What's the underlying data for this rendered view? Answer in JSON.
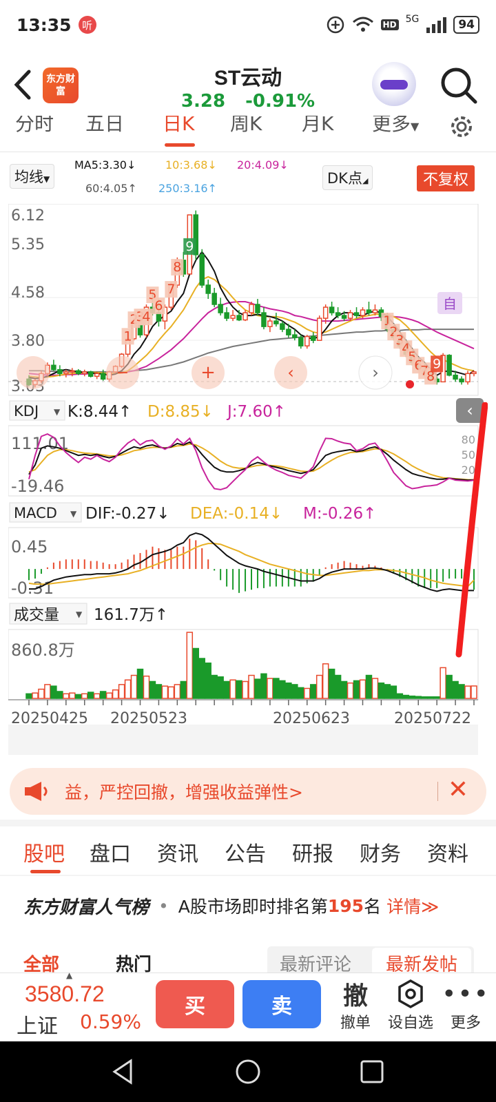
{
  "status_bar": {
    "time": "13:35",
    "app_badge": "听",
    "network": "5G",
    "hd": "HD",
    "battery": "94"
  },
  "header": {
    "logo_text": "东方财富",
    "stock_name": "ST云动",
    "price": "3.28",
    "change_pct": "-0.91%"
  },
  "period_tabs": [
    "分时",
    "五日",
    "日K",
    "周K",
    "月K",
    "更多"
  ],
  "ma_bar": {
    "selector": "均线",
    "ma5": "MA5:3.30↓",
    "ma10": "10:3.68↓",
    "ma20": "20:4.09↓",
    "ma60": "60:4.05↑",
    "ma250": "250:3.16↑",
    "dk_selector": "DK点",
    "fq_button": "不复权"
  },
  "indicators": {
    "kdj": {
      "selector": "KDJ",
      "k": "K:8.44↑",
      "d": "D:8.85↓",
      "j": "J:7.60↑"
    },
    "macd": {
      "selector": "MACD",
      "dif": "DIF:-0.27↓",
      "dea": "DEA:-0.14↓",
      "m": "M:-0.26↑"
    },
    "volume": {
      "selector": "成交量",
      "value": "161.7万↑"
    }
  },
  "colors": {
    "up": "#e8492c",
    "down": "#1a9a2a",
    "ma5": "#111111",
    "ma10": "#e8b024",
    "ma20": "#c8239c",
    "ma60": "#777777",
    "ma250": "#4aa3e0"
  },
  "chart_data": {
    "type": "candlestick",
    "price_axis_labels": [
      "6.12",
      "5.35",
      "4.58",
      "3.80",
      "3.03"
    ],
    "kdj_axis_labels": [
      "111.01",
      "-19.46"
    ],
    "kdj_ref_labels": [
      "80",
      "50",
      "20"
    ],
    "macd_axis_labels": [
      "0.45",
      "-0.31"
    ],
    "volume_axis_label": "860.8万",
    "date_labels": [
      "20250425",
      "20250523",
      "20250623",
      "20250722"
    ],
    "nine_turn_marks_up": [
      "1",
      "2",
      "3",
      "4",
      "5",
      "6",
      "7",
      "8",
      "9"
    ],
    "nine_turn_marks_down": [
      "1",
      "2",
      "3",
      "4",
      "5",
      "6",
      "7",
      "8",
      "9"
    ],
    "overlay_mark": "自",
    "candles": [
      [
        3.15,
        3.22,
        3.02,
        3.05
      ],
      [
        3.05,
        3.15,
        3.0,
        3.12
      ],
      [
        3.12,
        3.3,
        3.08,
        3.25
      ],
      [
        3.25,
        3.45,
        3.2,
        3.4
      ],
      [
        3.4,
        3.5,
        3.3,
        3.32
      ],
      [
        3.32,
        3.4,
        3.2,
        3.25
      ],
      [
        3.25,
        3.32,
        3.18,
        3.28
      ],
      [
        3.28,
        3.35,
        3.2,
        3.3
      ],
      [
        3.3,
        3.33,
        3.22,
        3.25
      ],
      [
        3.25,
        3.32,
        3.2,
        3.28
      ],
      [
        3.28,
        3.3,
        3.18,
        3.2
      ],
      [
        3.2,
        3.28,
        3.15,
        3.25
      ],
      [
        3.25,
        3.32,
        3.12,
        3.15
      ],
      [
        3.15,
        3.3,
        3.1,
        3.28
      ],
      [
        3.28,
        3.4,
        3.25,
        3.38
      ],
      [
        3.38,
        3.62,
        3.35,
        3.6
      ],
      [
        3.6,
        3.9,
        3.55,
        3.88
      ],
      [
        3.88,
        4.25,
        3.85,
        4.2
      ],
      [
        4.2,
        4.3,
        3.9,
        3.95
      ],
      [
        3.95,
        4.5,
        3.9,
        4.45
      ],
      [
        4.45,
        4.75,
        4.3,
        4.35
      ],
      [
        4.35,
        4.6,
        4.1,
        4.2
      ],
      [
        4.2,
        4.5,
        4.05,
        4.45
      ],
      [
        4.45,
        4.9,
        4.4,
        4.85
      ],
      [
        4.85,
        5.35,
        4.8,
        5.3
      ],
      [
        5.3,
        5.45,
        5.0,
        5.05
      ],
      [
        5.05,
        6.12,
        5.05,
        6.12
      ],
      [
        6.12,
        6.2,
        5.3,
        5.4
      ],
      [
        5.4,
        5.5,
        4.8,
        4.85
      ],
      [
        4.85,
        4.95,
        4.6,
        4.7
      ],
      [
        4.7,
        4.8,
        4.45,
        4.5
      ],
      [
        4.5,
        4.62,
        4.3,
        4.35
      ],
      [
        4.35,
        4.45,
        4.2,
        4.25
      ],
      [
        4.25,
        4.4,
        4.2,
        4.3
      ],
      [
        4.3,
        4.4,
        4.2,
        4.22
      ],
      [
        4.22,
        4.4,
        4.2,
        4.35
      ],
      [
        4.35,
        4.55,
        4.3,
        4.5
      ],
      [
        4.5,
        4.6,
        4.3,
        4.35
      ],
      [
        4.35,
        4.45,
        4.05,
        4.1
      ],
      [
        4.1,
        4.25,
        4.0,
        4.2
      ],
      [
        4.2,
        4.35,
        4.1,
        4.15
      ],
      [
        4.15,
        4.2,
        4.0,
        4.05
      ],
      [
        4.05,
        4.15,
        3.9,
        3.95
      ],
      [
        3.95,
        4.05,
        3.85,
        3.9
      ],
      [
        3.9,
        3.95,
        3.7,
        3.75
      ],
      [
        3.75,
        3.95,
        3.7,
        3.92
      ],
      [
        3.92,
        4.0,
        3.8,
        3.85
      ],
      [
        3.85,
        4.3,
        3.85,
        4.25
      ],
      [
        4.25,
        4.5,
        4.15,
        4.45
      ],
      [
        4.45,
        4.55,
        4.3,
        4.35
      ],
      [
        4.35,
        4.45,
        4.25,
        4.3
      ],
      [
        4.3,
        4.38,
        4.2,
        4.25
      ],
      [
        4.25,
        4.4,
        4.2,
        4.35
      ],
      [
        4.35,
        4.45,
        4.25,
        4.3
      ],
      [
        4.3,
        4.45,
        4.25,
        4.4
      ],
      [
        4.4,
        4.55,
        4.3,
        4.35
      ],
      [
        4.35,
        4.5,
        4.3,
        4.4
      ],
      [
        4.4,
        4.45,
        4.2,
        4.28
      ],
      [
        4.28,
        4.35,
        4.0,
        4.05
      ],
      [
        4.05,
        4.15,
        3.85,
        3.9
      ],
      [
        3.9,
        4.0,
        3.7,
        3.75
      ],
      [
        3.75,
        3.85,
        3.55,
        3.6
      ],
      [
        3.6,
        3.7,
        3.4,
        3.45
      ],
      [
        3.45,
        3.55,
        3.3,
        3.35
      ],
      [
        3.35,
        3.45,
        3.2,
        3.25
      ],
      [
        3.25,
        3.35,
        3.1,
        3.15
      ],
      [
        3.15,
        3.2,
        3.05,
        3.1
      ],
      [
        3.1,
        3.62,
        3.1,
        3.58
      ],
      [
        3.58,
        3.6,
        3.2,
        3.22
      ],
      [
        3.22,
        3.3,
        3.1,
        3.15
      ],
      [
        3.15,
        3.2,
        3.05,
        3.1
      ],
      [
        3.1,
        3.3,
        3.05,
        3.25
      ],
      [
        3.25,
        3.3,
        3.2,
        3.28
      ]
    ],
    "volumes": [
      60,
      70,
      120,
      180,
      160,
      90,
      60,
      70,
      50,
      60,
      80,
      60,
      90,
      70,
      110,
      180,
      240,
      300,
      380,
      290,
      220,
      180,
      160,
      150,
      180,
      220,
      860,
      650,
      520,
      460,
      300,
      280,
      220,
      240,
      230,
      220,
      300,
      250,
      320,
      260,
      260,
      230,
      200,
      180,
      140,
      130,
      180,
      300,
      450,
      380,
      300,
      220,
      200,
      230,
      240,
      300,
      260,
      200,
      180,
      160,
      60,
      40,
      30,
      25,
      20,
      20,
      20,
      400,
      300,
      220,
      180,
      160,
      161.7
    ],
    "ma5": [
      3.18,
      3.16,
      3.17,
      3.2,
      3.25,
      3.3,
      3.32,
      3.3,
      3.28,
      3.27,
      3.26,
      3.25,
      3.24,
      3.22,
      3.24,
      3.3,
      3.42,
      3.6,
      3.72,
      3.9,
      4.1,
      4.22,
      4.3,
      4.38,
      4.55,
      4.7,
      5.05,
      5.3,
      5.45,
      5.3,
      5.1,
      4.8,
      4.6,
      4.45,
      4.35,
      4.3,
      4.3,
      4.32,
      4.3,
      4.28,
      4.25,
      4.2,
      4.12,
      4.05,
      3.95,
      3.9,
      3.88,
      3.92,
      4.05,
      4.2,
      4.3,
      4.35,
      4.35,
      4.3,
      4.3,
      4.35,
      4.38,
      4.35,
      4.28,
      4.15,
      4.0,
      3.85,
      3.7,
      3.55,
      3.45,
      3.32,
      3.22,
      3.28,
      3.3,
      3.28,
      3.25,
      3.22,
      3.3
    ],
    "ma10": [
      3.2,
      3.19,
      3.18,
      3.19,
      3.2,
      3.22,
      3.24,
      3.25,
      3.26,
      3.26,
      3.27,
      3.27,
      3.26,
      3.25,
      3.25,
      3.26,
      3.3,
      3.38,
      3.48,
      3.58,
      3.7,
      3.85,
      3.98,
      4.1,
      4.25,
      4.4,
      4.6,
      4.8,
      4.95,
      5.0,
      4.95,
      4.85,
      4.75,
      4.62,
      4.5,
      4.4,
      4.35,
      4.3,
      4.28,
      4.28,
      4.28,
      4.26,
      4.22,
      4.18,
      4.12,
      4.05,
      4.0,
      3.98,
      4.0,
      4.05,
      4.1,
      4.15,
      4.2,
      4.25,
      4.28,
      4.3,
      4.32,
      4.33,
      4.32,
      4.28,
      4.22,
      4.12,
      4.0,
      3.88,
      3.76,
      3.64,
      3.54,
      3.5,
      3.45,
      3.4,
      3.35,
      3.32,
      3.3
    ],
    "ma20": [
      3.25,
      3.24,
      3.23,
      3.22,
      3.22,
      3.22,
      3.23,
      3.23,
      3.24,
      3.24,
      3.25,
      3.25,
      3.25,
      3.25,
      3.25,
      3.26,
      3.28,
      3.3,
      3.34,
      3.38,
      3.45,
      3.52,
      3.6,
      3.68,
      3.78,
      3.88,
      4.0,
      4.12,
      4.24,
      4.35,
      4.42,
      4.48,
      4.52,
      4.54,
      4.55,
      4.55,
      4.52,
      4.48,
      4.45,
      4.42,
      4.4,
      4.38,
      4.35,
      4.3,
      4.28,
      4.25,
      4.22,
      4.2,
      4.2,
      4.2,
      4.2,
      4.21,
      4.22,
      4.23,
      4.24,
      4.25,
      4.26,
      4.27,
      4.28,
      4.28,
      4.27,
      4.25,
      4.22,
      4.18,
      4.12,
      4.06,
      4.0,
      3.95,
      3.9,
      3.85,
      3.8,
      3.75,
      3.7
    ],
    "ma60": [
      3.3,
      3.3,
      3.3,
      3.29,
      3.29,
      3.29,
      3.28,
      3.28,
      3.28,
      3.28,
      3.28,
      3.28,
      3.28,
      3.28,
      3.28,
      3.28,
      3.29,
      3.3,
      3.31,
      3.32,
      3.34,
      3.36,
      3.38,
      3.4,
      3.43,
      3.46,
      3.5,
      3.54,
      3.58,
      3.62,
      3.65,
      3.68,
      3.71,
      3.74,
      3.76,
      3.78,
      3.8,
      3.82,
      3.84,
      3.86,
      3.87,
      3.88,
      3.89,
      3.9,
      3.91,
      3.92,
      3.93,
      3.94,
      3.95,
      3.96,
      3.97,
      3.98,
      3.99,
      4.0,
      4.0,
      4.01,
      4.02,
      4.02,
      4.03,
      4.03,
      4.03,
      4.04,
      4.04,
      4.04,
      4.05,
      4.05,
      4.05,
      4.05,
      4.05,
      4.05,
      4.05,
      4.05,
      4.05
    ],
    "kdj_k": [
      20,
      40,
      75,
      80,
      78,
      75,
      70,
      65,
      60,
      62,
      60,
      62,
      58,
      55,
      58,
      65,
      72,
      78,
      75,
      80,
      82,
      78,
      75,
      78,
      85,
      82,
      88,
      78,
      62,
      48,
      35,
      28,
      25,
      25,
      28,
      32,
      40,
      45,
      42,
      38,
      35,
      32,
      28,
      25,
      22,
      25,
      30,
      45,
      60,
      65,
      68,
      70,
      72,
      68,
      70,
      75,
      78,
      72,
      62,
      50,
      40,
      30,
      22,
      18,
      15,
      12,
      10,
      10,
      12,
      10,
      9,
      8,
      8.44
    ],
    "kdj_d": [
      25,
      30,
      45,
      60,
      68,
      72,
      72,
      70,
      67,
      65,
      64,
      63,
      61,
      59,
      59,
      61,
      65,
      70,
      72,
      75,
      77,
      77,
      76,
      77,
      80,
      81,
      84,
      82,
      76,
      68,
      58,
      48,
      40,
      35,
      33,
      33,
      36,
      39,
      40,
      39,
      38,
      36,
      33,
      30,
      27,
      26,
      27,
      33,
      42,
      50,
      57,
      62,
      66,
      67,
      68,
      71,
      74,
      73,
      69,
      63,
      55,
      47,
      38,
      31,
      25,
      20,
      16,
      13,
      12,
      11,
      10,
      9,
      8.85
    ],
    "kdj_j": [
      10,
      60,
      100,
      105,
      98,
      80,
      66,
      55,
      45,
      56,
      52,
      60,
      52,
      47,
      56,
      73,
      86,
      94,
      82,
      90,
      92,
      80,
      73,
      80,
      95,
      84,
      96,
      70,
      34,
      8,
      -10,
      -12,
      -8,
      5,
      18,
      30,
      48,
      57,
      46,
      36,
      29,
      24,
      18,
      15,
      12,
      23,
      36,
      69,
      96,
      95,
      90,
      86,
      84,
      70,
      74,
      83,
      86,
      70,
      48,
      24,
      10,
      -4,
      -10,
      -8,
      -5,
      -4,
      -2,
      4,
      12,
      8,
      7,
      6,
      7.6
    ],
    "macd_dif": [
      -0.25,
      -0.25,
      -0.22,
      -0.18,
      -0.14,
      -0.12,
      -0.1,
      -0.09,
      -0.08,
      -0.07,
      -0.07,
      -0.06,
      -0.06,
      -0.06,
      -0.05,
      -0.03,
      0.0,
      0.05,
      0.08,
      0.13,
      0.18,
      0.2,
      0.22,
      0.25,
      0.3,
      0.33,
      0.42,
      0.45,
      0.43,
      0.38,
      0.31,
      0.24,
      0.17,
      0.12,
      0.07,
      0.04,
      0.02,
      0.0,
      -0.03,
      -0.05,
      -0.07,
      -0.09,
      -0.11,
      -0.13,
      -0.15,
      -0.15,
      -0.15,
      -0.12,
      -0.07,
      -0.04,
      -0.02,
      0.0,
      0.0,
      0.0,
      0.0,
      0.01,
      0.01,
      0.0,
      -0.02,
      -0.05,
      -0.08,
      -0.12,
      -0.16,
      -0.2,
      -0.23,
      -0.26,
      -0.28,
      -0.26,
      -0.25,
      -0.26,
      -0.27,
      -0.27,
      -0.27
    ],
    "macd_dea": [
      -0.18,
      -0.19,
      -0.19,
      -0.19,
      -0.18,
      -0.17,
      -0.16,
      -0.15,
      -0.14,
      -0.13,
      -0.12,
      -0.11,
      -0.1,
      -0.09,
      -0.08,
      -0.07,
      -0.06,
      -0.04,
      -0.02,
      0.01,
      0.04,
      0.07,
      0.1,
      0.13,
      0.16,
      0.19,
      0.23,
      0.27,
      0.3,
      0.32,
      0.32,
      0.31,
      0.28,
      0.25,
      0.22,
      0.18,
      0.15,
      0.12,
      0.09,
      0.06,
      0.04,
      0.02,
      0.0,
      -0.02,
      -0.04,
      -0.06,
      -0.07,
      -0.08,
      -0.08,
      -0.07,
      -0.06,
      -0.05,
      -0.04,
      -0.03,
      -0.02,
      -0.02,
      -0.01,
      -0.01,
      -0.01,
      -0.02,
      -0.03,
      -0.05,
      -0.07,
      -0.09,
      -0.11,
      -0.14,
      -0.16,
      -0.18,
      -0.19,
      -0.2,
      -0.21,
      -0.22,
      -0.14
    ]
  },
  "ad_banner": {
    "text": "益，严控回撤，增强收益弹性>"
  },
  "info_tabs": [
    "股吧",
    "盘口",
    "资讯",
    "公告",
    "研报",
    "财务",
    "资料"
  ],
  "rank": {
    "brand": "东方财富人气榜",
    "text_before": "A股市场即时排名第",
    "rank_number": "195",
    "text_after": "名",
    "detail": "详情≫"
  },
  "sub_tabs": [
    "全部",
    "热门",
    "最新评论",
    "最新发帖"
  ],
  "bottom_bar": {
    "index_value": "3580.72",
    "index_name": "上证",
    "index_change": "0.59%",
    "buy": "买",
    "sell": "卖",
    "cancel_icon": "撤",
    "cancel": "撤单",
    "add_watch": "设自选",
    "more": "更多"
  }
}
